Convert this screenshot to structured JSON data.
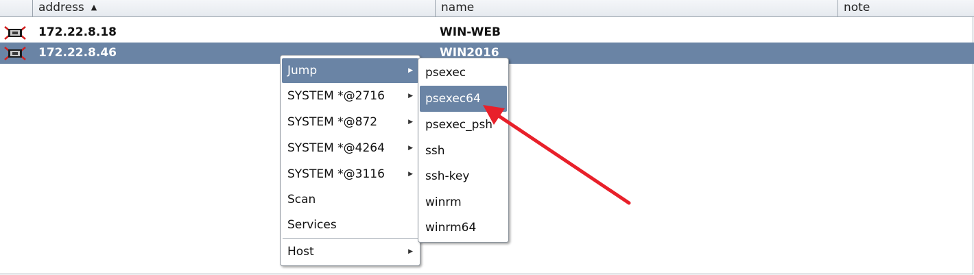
{
  "table": {
    "columns": [
      {
        "label": ""
      },
      {
        "label": "address",
        "sort": "ascending"
      },
      {
        "label": "name"
      },
      {
        "label": "note"
      }
    ],
    "rows": [
      {
        "icon": "windows-session-icon",
        "address": "172.22.8.18",
        "name": "WIN-WEB",
        "note": "",
        "selected": false
      },
      {
        "icon": "windows-session-icon",
        "address": "172.22.8.46",
        "name": "WIN2016",
        "note": "",
        "selected": true
      }
    ]
  },
  "context_menu": {
    "items": [
      {
        "label": "Jump",
        "submenu": true,
        "highlighted": true
      },
      {
        "label": "SYSTEM *@2716",
        "submenu": true
      },
      {
        "label": "SYSTEM *@872",
        "submenu": true
      },
      {
        "label": "SYSTEM *@4264",
        "submenu": true
      },
      {
        "label": "SYSTEM *@3116",
        "submenu": true
      },
      {
        "label": "Scan",
        "submenu": false
      },
      {
        "label": "Services",
        "submenu": false
      },
      {
        "label": "Host",
        "submenu": true
      }
    ]
  },
  "jump_submenu": {
    "items": [
      {
        "label": "psexec"
      },
      {
        "label": "psexec64",
        "highlighted": true
      },
      {
        "label": "psexec_psh"
      },
      {
        "label": "ssh"
      },
      {
        "label": "ssh-key"
      },
      {
        "label": "winrm"
      },
      {
        "label": "winrm64"
      }
    ]
  },
  "colors": {
    "selection": "#6a84a5",
    "annotation_arrow": "#e8202a",
    "header_bg": "#e9edf2"
  },
  "icons": {
    "sort_ascending": "triangle-up",
    "submenu": "triangle-right"
  }
}
